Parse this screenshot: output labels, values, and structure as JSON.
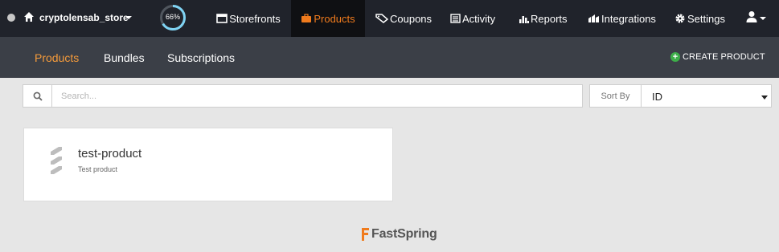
{
  "store": {
    "name": "cryptolensab_store"
  },
  "progress": {
    "value": 66,
    "label": "66%"
  },
  "nav": {
    "storefronts": "Storefronts",
    "products": "Products",
    "coupons": "Coupons",
    "activity": "Activity",
    "reports": "Reports",
    "integrations": "Integrations",
    "settings": "Settings"
  },
  "subnav": {
    "products": "Products",
    "bundles": "Bundles",
    "subscriptions": "Subscriptions",
    "create_label": "CREATE PRODUCT"
  },
  "search": {
    "placeholder": "Search...",
    "value": ""
  },
  "sort": {
    "label": "Sort By",
    "value": "ID"
  },
  "products": [
    {
      "name": "test-product",
      "description": "Test product"
    }
  ],
  "footer": {
    "brand": "FastSpring"
  },
  "colors": {
    "accent": "#f07b1d",
    "topnav": "#20232b",
    "subnav": "#3b3f47",
    "create_icon": "#3dae49",
    "progress": "#7fd3f3"
  }
}
